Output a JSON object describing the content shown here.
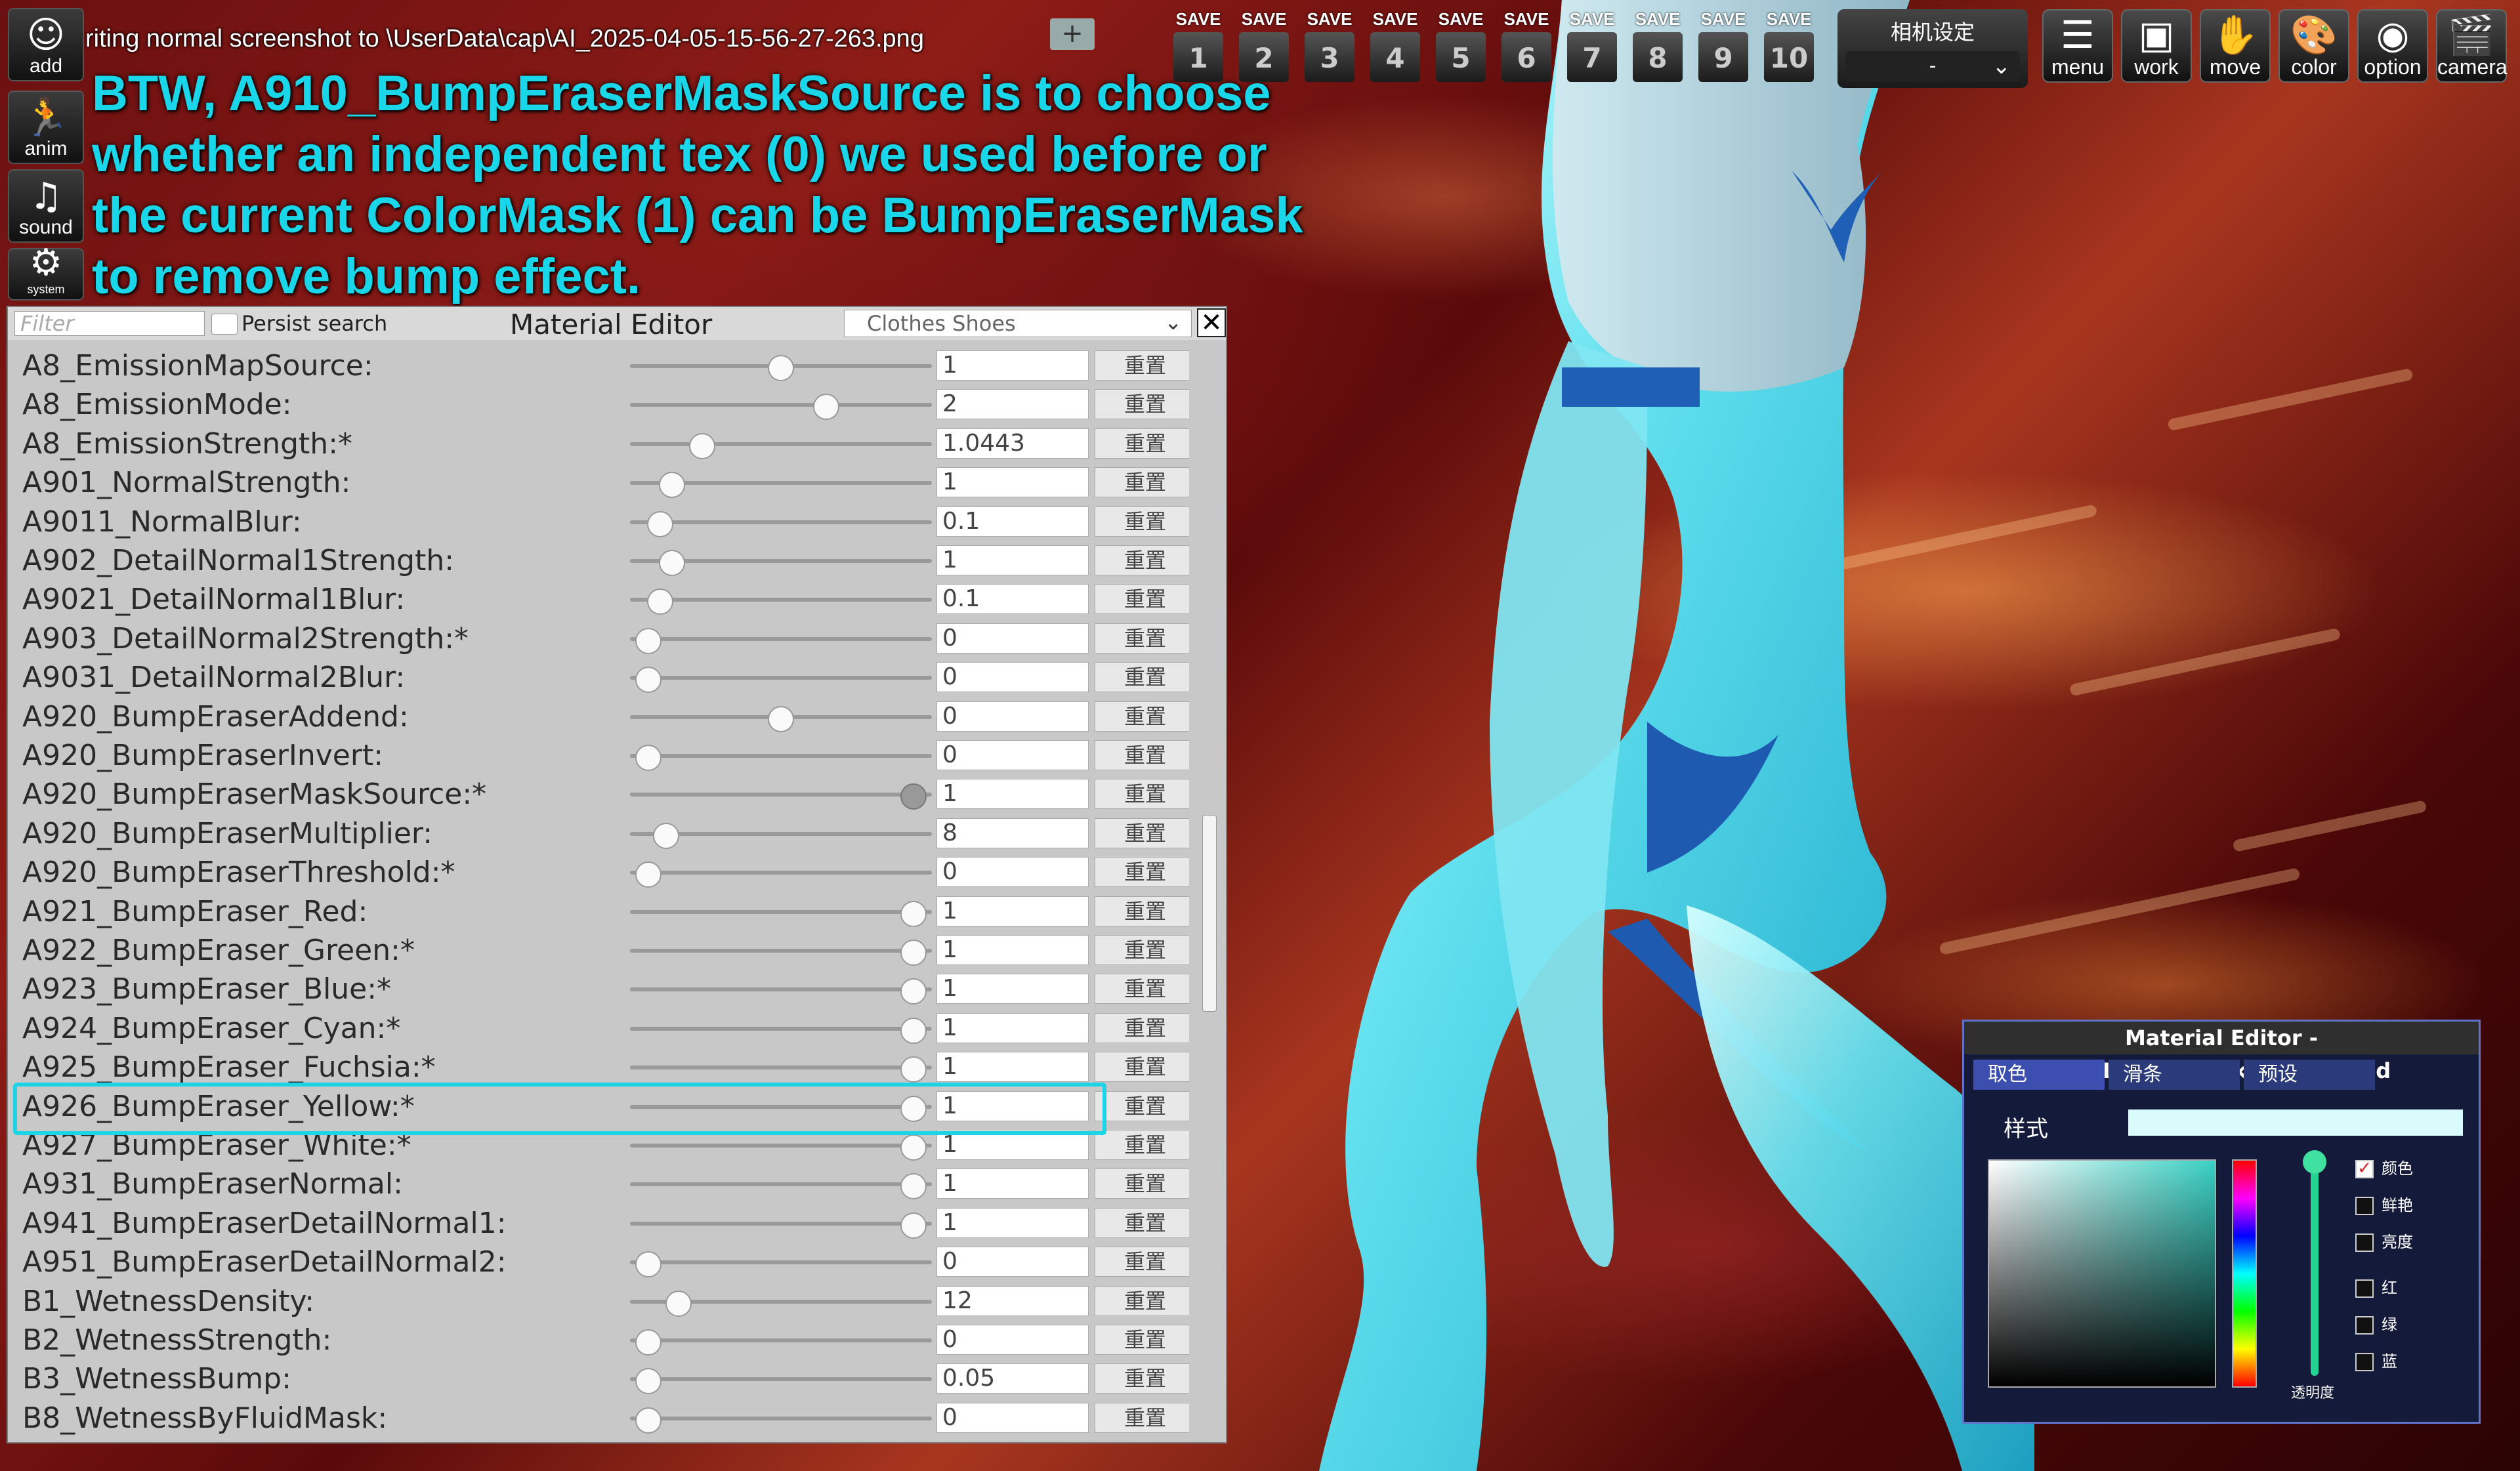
{
  "side_icons": [
    {
      "label": "add",
      "icon": "add-person-icon"
    },
    {
      "label": "anim",
      "icon": "running-figure-icon"
    },
    {
      "label": "sound",
      "icon": "music-note-icon"
    },
    {
      "label": "system",
      "icon": "gear-icon"
    }
  ],
  "status_text": "riting normal screenshot to \\UserData\\cap\\AI_2025-04-05-15-56-27-263.png",
  "zoom_plus": "+",
  "annotation": [
    "BTW, A910_BumpEraserMaskSource is to choose",
    "whether an independent tex (0) we used before or",
    "the current ColorMask (1) can be BumpEraserMask",
    "to remove bump effect."
  ],
  "toolbar": {
    "save_label": "SAVE",
    "save_slots": [
      "1",
      "2",
      "3",
      "4",
      "5",
      "6",
      "7",
      "8",
      "9",
      "10"
    ],
    "camera_settings_title": "相机设定",
    "camera_settings_value": "-",
    "tools": [
      {
        "label": "menu",
        "icon": "menu-list-icon"
      },
      {
        "label": "work",
        "icon": "work-frame-icon"
      },
      {
        "label": "move",
        "icon": "hand-icon"
      },
      {
        "label": "color",
        "icon": "palette-icon"
      },
      {
        "label": "option",
        "icon": "eye-icon"
      },
      {
        "label": "camera",
        "icon": "clapperboard-icon"
      }
    ]
  },
  "material_editor": {
    "title": "Material Editor",
    "filter_placeholder": "Filter",
    "persist_search_label": "Persist search",
    "category": "Clothes Shoes",
    "reset_label": "重置",
    "rows": [
      {
        "name": "A8_EmissionMapSource:",
        "value": "1",
        "slider": 0.5
      },
      {
        "name": "A8_EmissionMode:",
        "value": "2",
        "slider": 0.65
      },
      {
        "name": "A8_EmissionStrength:*",
        "value": "1.0443",
        "slider": 0.24
      },
      {
        "name": "A901_NormalStrength:",
        "value": "1",
        "slider": 0.14
      },
      {
        "name": "A9011_NormalBlur:",
        "value": "0.1",
        "slider": 0.1
      },
      {
        "name": "A902_DetailNormal1Strength:",
        "value": "1",
        "slider": 0.14
      },
      {
        "name": "A9021_DetailNormal1Blur:",
        "value": "0.1",
        "slider": 0.1
      },
      {
        "name": "A903_DetailNormal2Strength:*",
        "value": "0",
        "slider": 0.06
      },
      {
        "name": "A9031_DetailNormal2Blur:",
        "value": "0",
        "slider": 0.06
      },
      {
        "name": "A920_BumpEraserAddend:",
        "value": "0",
        "slider": 0.5
      },
      {
        "name": "A920_BumpEraserInvert:",
        "value": "0",
        "slider": 0.06
      },
      {
        "name": "A920_BumpEraserMaskSource:*",
        "value": "1",
        "slider": 0.94
      },
      {
        "name": "A920_BumpEraserMultiplier:",
        "value": "8",
        "slider": 0.12
      },
      {
        "name": "A920_BumpEraserThreshold:*",
        "value": "0",
        "slider": 0.06
      },
      {
        "name": "A921_BumpEraser_Red:",
        "value": "1",
        "slider": 0.94
      },
      {
        "name": "A922_BumpEraser_Green:*",
        "value": "1",
        "slider": 0.94
      },
      {
        "name": "A923_BumpEraser_Blue:*",
        "value": "1",
        "slider": 0.94
      },
      {
        "name": "A924_BumpEraser_Cyan:*",
        "value": "1",
        "slider": 0.94
      },
      {
        "name": "A925_BumpEraser_Fuchsia:*",
        "value": "1",
        "slider": 0.94
      },
      {
        "name": "A926_BumpEraser_Yellow:*",
        "value": "1",
        "slider": 0.94
      },
      {
        "name": "A927_BumpEraser_White:*",
        "value": "1",
        "slider": 0.94
      },
      {
        "name": "A931_BumpEraserNormal:",
        "value": "1",
        "slider": 0.94
      },
      {
        "name": "A941_BumpEraserDetailNormal1:",
        "value": "1",
        "slider": 0.94
      },
      {
        "name": "A951_BumpEraserDetailNormal2:",
        "value": "0",
        "slider": 0.06
      },
      {
        "name": "B1_WetnessDensity:",
        "value": "12",
        "slider": 0.16
      },
      {
        "name": "B2_WetnessStrength:",
        "value": "0",
        "slider": 0.06
      },
      {
        "name": "B3_WetnessBump:",
        "value": "0.05",
        "slider": 0.06
      },
      {
        "name": "B8_WetnessByFluidMask:",
        "value": "0",
        "slider": 0.06
      }
    ],
    "highlighted_row": 11
  },
  "color_picker": {
    "title": "Material Editor - D911_ColorMaskToColor_Red",
    "tabs": [
      "取色",
      "滑条",
      "预设"
    ],
    "active_tab": 0,
    "style_label": "样式",
    "alpha_label": "透明度",
    "options": [
      {
        "label": "颜色",
        "checked": true
      },
      {
        "label": "鲜艳",
        "checked": false
      },
      {
        "label": "亮度",
        "checked": false
      },
      {
        "label": "红",
        "checked": false
      },
      {
        "label": "绿",
        "checked": false
      },
      {
        "label": "蓝",
        "checked": false
      }
    ],
    "swatch_color": "#d9fbfb"
  },
  "colors": {
    "annotation": "#19d6e8",
    "highlight": "#1cd4e6",
    "panel": "#c8c8c8"
  }
}
